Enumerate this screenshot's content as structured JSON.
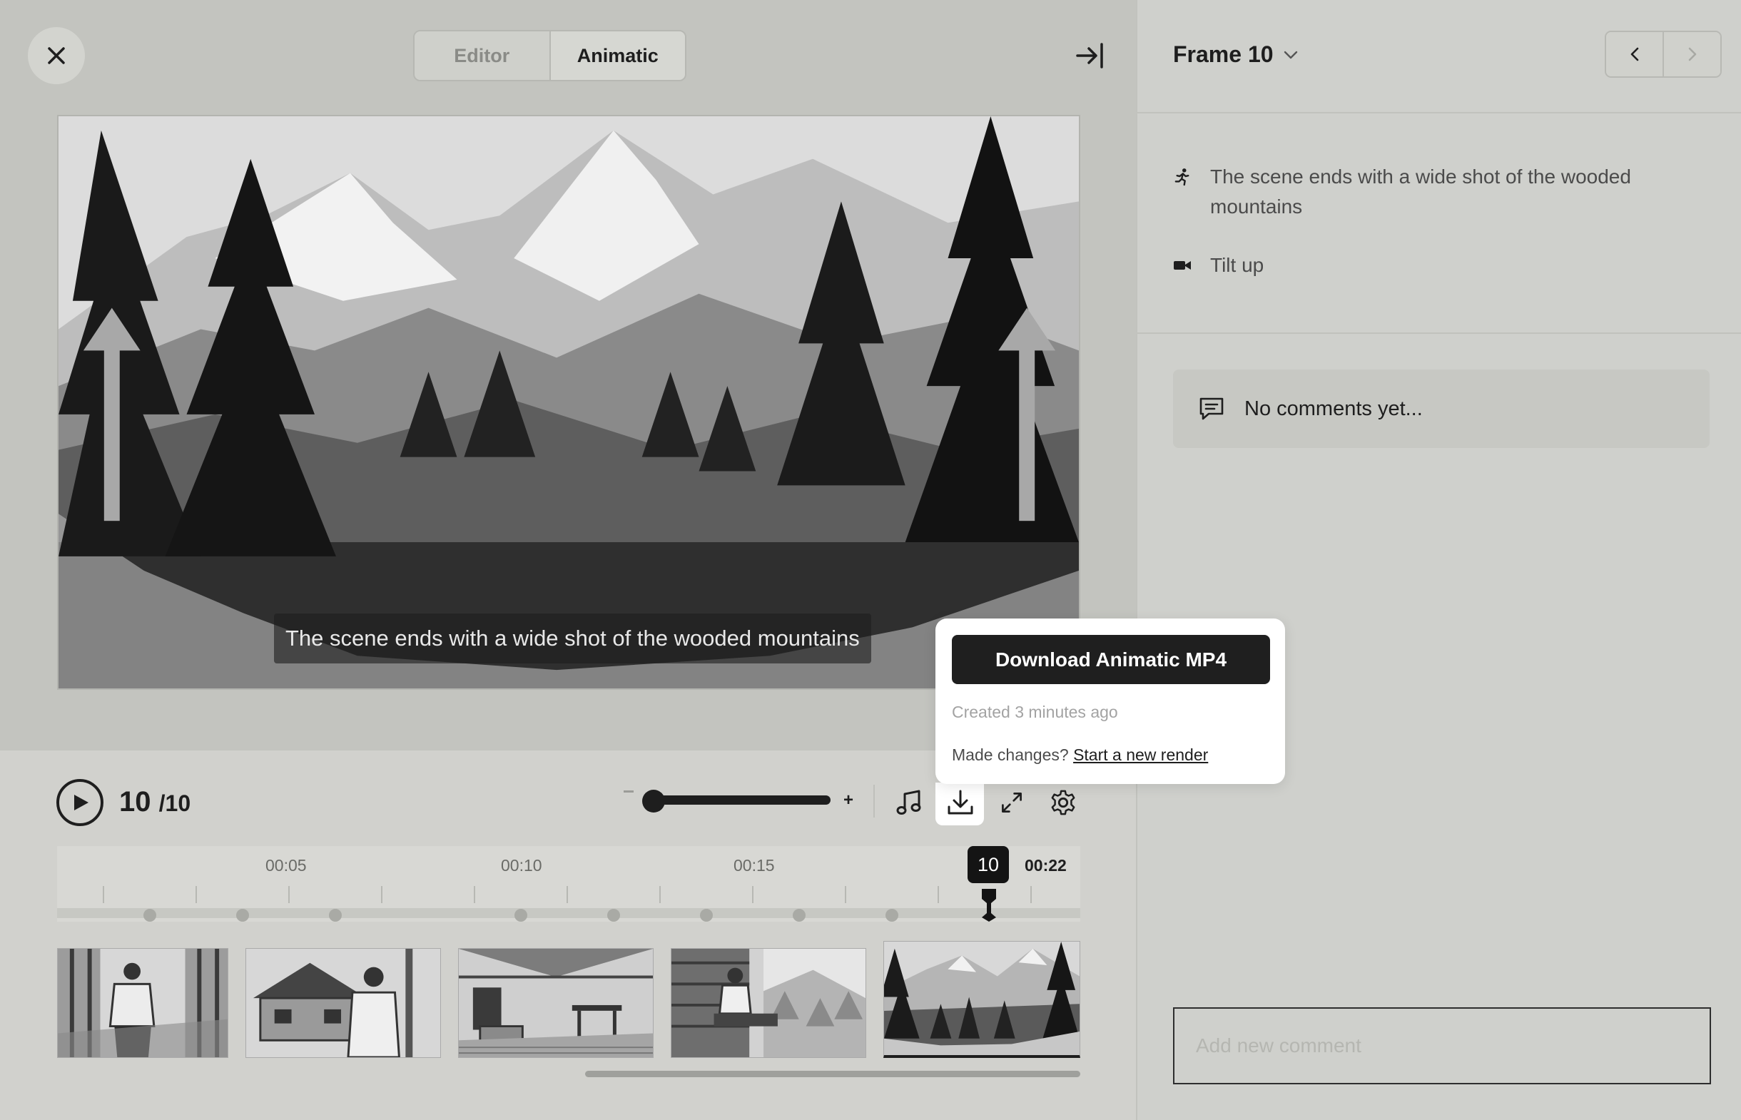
{
  "header": {
    "tabs": [
      {
        "label": "Editor",
        "active": false
      },
      {
        "label": "Animatic",
        "active": true
      }
    ]
  },
  "preview": {
    "caption": "The scene ends with a wide shot of the wooded mountains"
  },
  "download_popover": {
    "button_label": "Download Animatic MP4",
    "created": "Created 3 minutes ago",
    "changes_prompt": "Made changes?",
    "render_link": "Start a new render"
  },
  "player": {
    "current_frame": "10",
    "total_frames": "/10",
    "zoom_plus": "+"
  },
  "timeline": {
    "labels": [
      "00:05",
      "00:10",
      "00:15"
    ],
    "end_time": "00:22",
    "playhead_frame": "10"
  },
  "sidebar": {
    "frame_title": "Frame 10",
    "action_text": "The scene ends with a wide shot of the wooded mountains",
    "camera_text": "Tilt up",
    "comments_empty": "No comments yet...",
    "comment_placeholder": "Add new comment"
  },
  "icons": {
    "close": "close-icon",
    "collapse": "collapse-panel-icon",
    "play": "play-icon",
    "music": "music-note-icon",
    "download": "download-icon",
    "fullscreen": "expand-icon",
    "settings": "gear-icon",
    "action": "running-figure-icon",
    "camera": "video-camera-icon",
    "comment": "comment-icon",
    "prev": "chevron-left-icon",
    "next": "chevron-right-icon",
    "dropdown": "chevron-down-icon"
  }
}
